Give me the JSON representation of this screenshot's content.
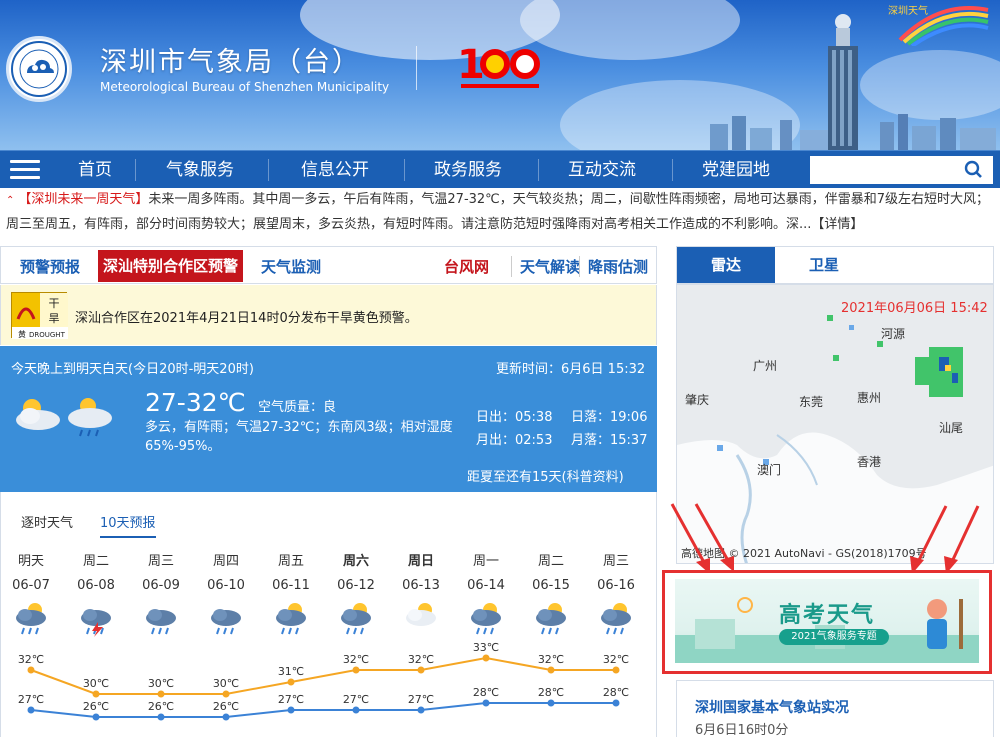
{
  "header": {
    "title": "深圳市气象局（台）",
    "subtitle": "Meteorological Bureau of Shenzhen Municipality",
    "centenary_number": "100",
    "banner_small_text": "深圳天气"
  },
  "nav": {
    "items": [
      "首页",
      "气象服务",
      "信息公开",
      "政务服务",
      "互动交流",
      "党建园地"
    ],
    "search_placeholder": ""
  },
  "ticker": {
    "lead": "【深圳未来一周天气】",
    "text": "未来一周多阵雨。其中周一多云，午后有阵雨，气温27-32℃，天气较炎热；周二，间歇性阵雨频密，局地可达暴雨，伴雷暴和7级左右短时大风；周三至周五，有阵雨，部分时间雨势较大；展望周末，多云炎热，有短时阵雨。请注意防范短时强降雨对高考相关工作造成的不利影响。深...",
    "detail": "【详情】"
  },
  "warning_tabs": {
    "tab1": "预警预报",
    "tab_active": "深汕特别合作区预警",
    "tab3": "天气监测",
    "link1": "台风网",
    "link2": "天气解读",
    "link3": "降雨估测"
  },
  "warning": {
    "icon_top": "干旱",
    "icon_level": "黄",
    "icon_en": "DROUGHT",
    "text": "深汕合作区在2021年4月21日14时0分发布干旱黄色预警。"
  },
  "current": {
    "period": "今天晚上到明天白天(今日20时-明天20时)",
    "updated": "更新时间：6月6日 15:32",
    "temp": "27-32℃",
    "aq_label": "空气质量：",
    "aq_value": "良",
    "desc": "多云，有阵雨；气温27-32℃；东南风3级；相对湿度65%-95%。",
    "sunrise": "日出：05:38",
    "sunset": "日落：19:06",
    "moonrise": "月出：02:53",
    "moonset": "月落：15:37",
    "summer": "距夏至还有15天(科普资料)"
  },
  "forecast_tabs": {
    "hourly": "逐时天气",
    "ten_day": "10天预报"
  },
  "forecast": {
    "days": [
      "明天",
      "周二",
      "周三",
      "周四",
      "周五",
      "周六",
      "周日",
      "周一",
      "周二",
      "周三"
    ],
    "bold_days": [
      false,
      false,
      false,
      false,
      false,
      true,
      true,
      false,
      false,
      false
    ],
    "dates": [
      "06-07",
      "06-08",
      "06-09",
      "06-10",
      "06-11",
      "06-12",
      "06-13",
      "06-14",
      "06-15",
      "06-16"
    ],
    "icons": [
      "partly-cloudy-rain-icon",
      "thunderstorm-icon",
      "rain-icon",
      "rain-icon",
      "partly-cloudy-rain-icon",
      "partly-cloudy-rain-icon",
      "partly-cloudy-icon",
      "partly-cloudy-rain-icon",
      "partly-cloudy-rain-icon",
      "partly-cloudy-rain-icon"
    ],
    "highs": [
      32,
      30,
      30,
      30,
      31,
      32,
      32,
      33,
      32,
      32
    ],
    "lows": [
      27,
      26,
      26,
      26,
      27,
      27,
      27,
      28,
      28,
      28
    ],
    "high_labels": [
      "32℃",
      "30℃",
      "30℃",
      "30℃",
      "31℃",
      "32℃",
      "32℃",
      "33℃",
      "32℃",
      "32℃"
    ],
    "low_labels": [
      "27℃",
      "26℃",
      "26℃",
      "26℃",
      "27℃",
      "27℃",
      "27℃",
      "28℃",
      "28℃",
      "28℃"
    ],
    "high_color": "#f5a623",
    "low_color": "#3b82d6"
  },
  "radar": {
    "tab_active": "雷达",
    "tab2": "卫星",
    "timestamp": "2021年06月06日 15:42",
    "copyright": "高德地图 © 2021 AutoNavi - GS(2018)1709号",
    "cities": [
      "河源",
      "广州",
      "肇庆",
      "东莞",
      "惠州",
      "汕尾",
      "澳门",
      "香港"
    ]
  },
  "banner": {
    "title": "高考天气",
    "ribbon": "2021气象服务专题"
  },
  "station": {
    "name": "深圳国家基本气象站实况",
    "time": "6月6日16时0分"
  },
  "colors": {
    "brand_blue": "#1b5fb4",
    "alert_red": "#c4151c",
    "panel_blue": "#3a8ed9",
    "annotation_red": "#e53030"
  }
}
